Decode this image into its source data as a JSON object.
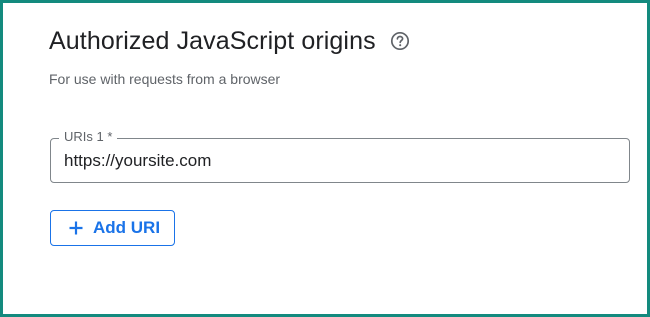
{
  "section": {
    "title": "Authorized JavaScript origins",
    "subtitle": "For use with requests from a browser",
    "help_icon": "help-circle-icon"
  },
  "uri_field": {
    "label": "URIs 1 *",
    "value": "https://yoursite.com"
  },
  "add_button": {
    "label": "Add URI",
    "icon": "plus-icon"
  },
  "colors": {
    "frame_border": "#138a7e",
    "accent": "#1a73e8",
    "title_text": "#202124",
    "secondary_text": "#5f6368",
    "field_border": "#80868b"
  }
}
